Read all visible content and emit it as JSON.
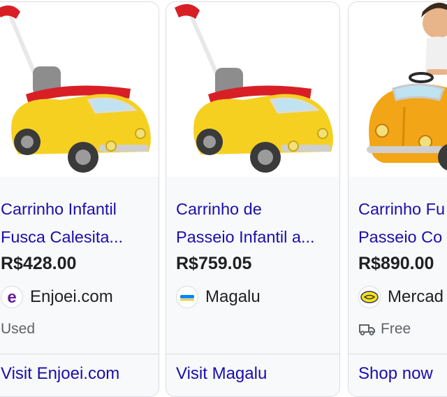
{
  "cards": [
    {
      "title_line1": "Carrinho Infantil",
      "title_line2": "Fusca Calesita...",
      "price": "R$428.00",
      "merchant": "Enjoei.com",
      "condition": "Used",
      "action": "Visit Enjoei.com"
    },
    {
      "title_line1": "Carrinho de",
      "title_line2": "Passeio Infantil a...",
      "price": "R$759.05",
      "merchant": "Magalu",
      "action": "Visit Magalu"
    },
    {
      "title_line1": "Carrinho Fu",
      "title_line2": "Passeio Co",
      "price": "R$890.00",
      "merchant": "Mercad",
      "shipping": "Free",
      "action": "Shop now"
    }
  ],
  "colors": {
    "link": "#1a0dab",
    "text": "#202124",
    "muted": "#5f6368",
    "border": "#dadce0",
    "toy_yellow": "#f5d020",
    "toy_orange": "#f2a516"
  },
  "icons": {
    "enjoei_logo": "enjoei-logo-icon",
    "magalu_logo": "magalu-logo-icon",
    "mercado_logo": "mercado-livre-logo-icon",
    "shipping": "truck-icon"
  }
}
